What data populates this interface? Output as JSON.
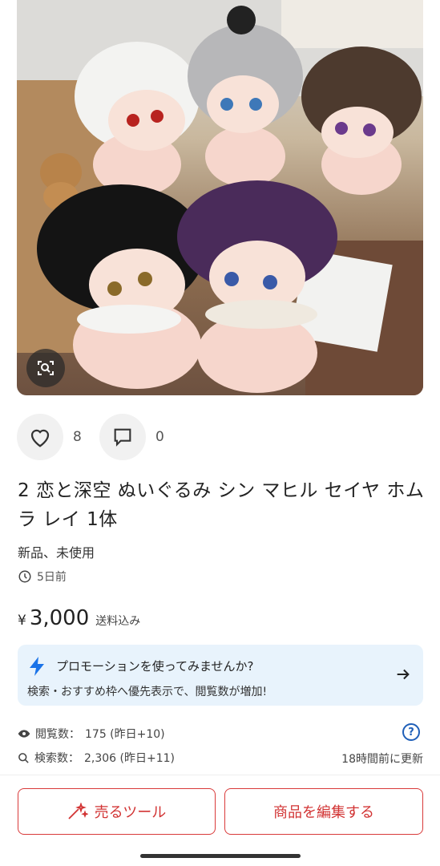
{
  "likes": {
    "count": "8"
  },
  "comments": {
    "count": "0"
  },
  "item": {
    "title": "2 恋と深空 ぬいぐるみ シン マヒル セイヤ ホムラ レイ 1体",
    "condition": "新品、未使用",
    "posted": "5日前",
    "currency": "¥",
    "price": "3,000",
    "shipping": "送料込み"
  },
  "promo": {
    "title": "プロモーションを使ってみませんか?",
    "description": "検索・おすすめ枠へ優先表示で、閲覧数が増加!"
  },
  "stats": {
    "views_label": "閲覧数：",
    "views_value": "175 (昨日+10)",
    "search_label": "検索数：",
    "search_value": "2,306 (昨日+11)",
    "updated": "18時間前に更新",
    "help": "?"
  },
  "actions": {
    "sell_tool": "売るツール",
    "edit_item": "商品を編集する"
  },
  "colors": {
    "accent_red": "#d23434",
    "promo_bg": "#e8f3fc",
    "bolt_blue": "#1a73e8"
  }
}
